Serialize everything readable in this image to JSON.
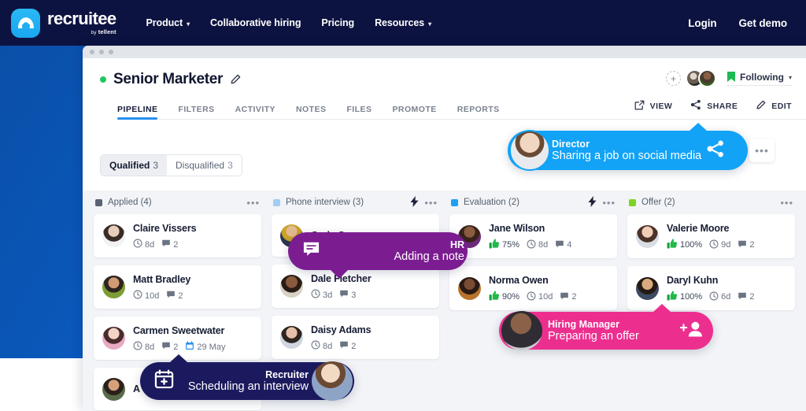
{
  "topnav": {
    "logo": {
      "word": "recruitee",
      "by": "by",
      "brand": "tellent",
      "icon": "recruitee-logo-icon"
    },
    "links": [
      {
        "label": "Product",
        "caret": "⌄"
      },
      {
        "label": "Collaborative hiring",
        "caret": ""
      },
      {
        "label": "Pricing",
        "caret": ""
      },
      {
        "label": "Resources",
        "caret": "⌄"
      }
    ],
    "login": "Login",
    "demo": "Get demo"
  },
  "app": {
    "job_title": "Senior Marketer",
    "status": "open",
    "tabs": [
      {
        "label": "PIPELINE",
        "active": true
      },
      {
        "label": "FILTERS",
        "active": false
      },
      {
        "label": "ACTIVITY",
        "active": false
      },
      {
        "label": "NOTES",
        "active": false
      },
      {
        "label": "FILES",
        "active": false
      },
      {
        "label": "PROMOTE",
        "active": false
      },
      {
        "label": "REPORTS",
        "active": false
      }
    ],
    "header_right": {
      "add_person": "+",
      "following_label": "Following",
      "chevron": "▾",
      "actions": [
        {
          "label": "VIEW",
          "icon": "external-link-icon"
        },
        {
          "label": "SHARE",
          "icon": "share-icon"
        },
        {
          "label": "EDIT",
          "icon": "pencil-icon"
        }
      ]
    },
    "pills": [
      {
        "label": "Qualified",
        "count": "3",
        "active": true
      },
      {
        "label": "Disqualified",
        "count": "3",
        "active": false
      }
    ],
    "kebab": "•••"
  },
  "board": {
    "columns": [
      {
        "name": "Applied",
        "count": "(4)",
        "color": "#5a6374",
        "has_bolt": false,
        "cards": [
          {
            "name": "Claire Vissers",
            "days": "8d",
            "comments": "2",
            "pct": "",
            "date": ""
          },
          {
            "name": "Matt Bradley",
            "days": "10d",
            "comments": "2",
            "pct": "",
            "date": ""
          },
          {
            "name": "Carmen Sweetwater",
            "days": "8d",
            "comments": "2",
            "pct": "",
            "date": "29 May"
          },
          {
            "name": "A",
            "days": "",
            "comments": "",
            "pct": "",
            "date": ""
          }
        ]
      },
      {
        "name": "Phone interview",
        "count": "(3)",
        "color": "#9fcdf3",
        "has_bolt": true,
        "cards": [
          {
            "name": "Cody Cruz",
            "days": "",
            "comments": "",
            "pct": "",
            "date": ""
          },
          {
            "name": "Dale Fletcher",
            "days": "3d",
            "comments": "3",
            "pct": "",
            "date": ""
          },
          {
            "name": "Daisy Adams",
            "days": "8d",
            "comments": "2",
            "pct": "",
            "date": ""
          }
        ]
      },
      {
        "name": "Evaluation",
        "count": "(2)",
        "color": "#1e9ff2",
        "has_bolt": true,
        "cards": [
          {
            "name": "Jane Wilson",
            "days": "8d",
            "comments": "4",
            "pct": "75%",
            "date": ""
          },
          {
            "name": "Norma Owen",
            "days": "10d",
            "comments": "2",
            "pct": "90%",
            "date": ""
          }
        ]
      },
      {
        "name": "Offer",
        "count": "(2)",
        "color": "#7ed321",
        "has_bolt": false,
        "cards": [
          {
            "name": "Valerie Moore",
            "days": "9d",
            "comments": "2",
            "pct": "100%",
            "date": ""
          },
          {
            "name": "Daryl Kuhn",
            "days": "6d",
            "comments": "2",
            "pct": "100%",
            "date": ""
          }
        ]
      }
    ]
  },
  "callouts": {
    "director": {
      "role": "Director",
      "action": "Sharing a job on social media",
      "icon": "share-icon",
      "color": "#12a3f7"
    },
    "hr": {
      "role": "HR",
      "action": "Adding a note",
      "icon": "note-icon",
      "color": "#7b1d91"
    },
    "hiring_manager": {
      "role": "Hiring Manager",
      "action": "Preparing an offer",
      "icon": "add-person-icon",
      "color": "#ec2f8f"
    },
    "recruiter": {
      "role": "Recruiter",
      "action": "Scheduling an interview",
      "icon": "calendar-plus-icon",
      "color": "#1c1a5e"
    }
  }
}
